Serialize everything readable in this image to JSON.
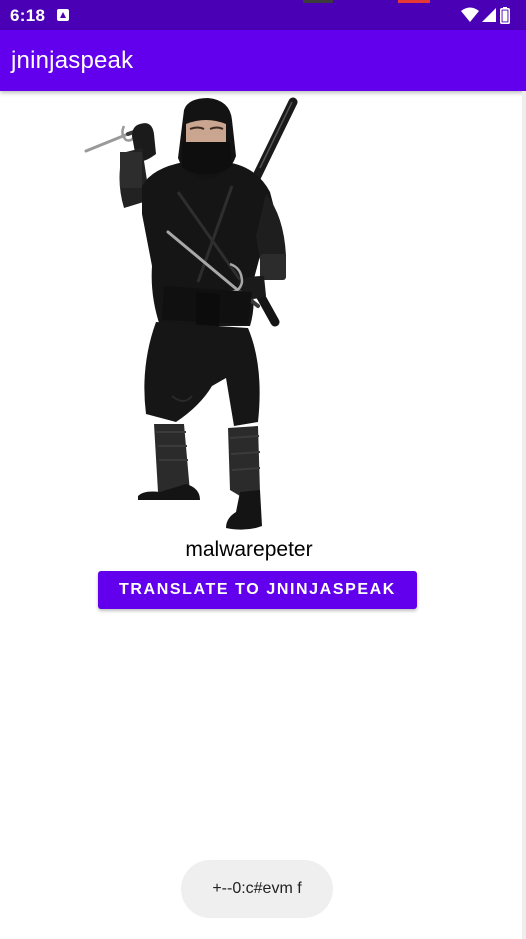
{
  "status_bar": {
    "time": "6:18",
    "background": "#4a00b4",
    "icons": [
      "notification-icon",
      "wifi-icon",
      "signal-icon",
      "battery-icon"
    ]
  },
  "app_bar": {
    "title": "jninjaspeak",
    "background": "#6200ee"
  },
  "main": {
    "image": "ninja-costume-image",
    "username": "malwarepeter",
    "translate_button_label": "Translate to jninjaspeak",
    "accent": "#6200ee"
  },
  "toast": {
    "message": "+--0:c#evm f"
  }
}
